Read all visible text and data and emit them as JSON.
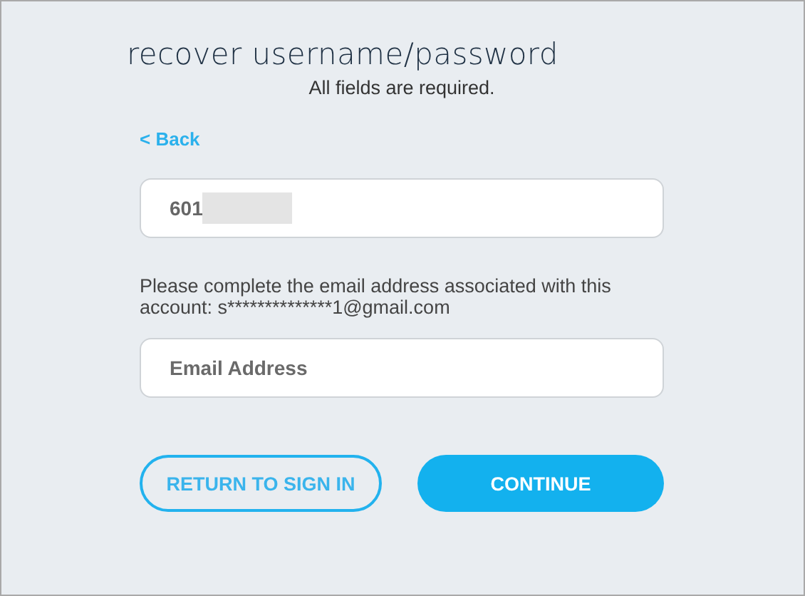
{
  "title": "recover username/password",
  "subtitle": "All fields are required.",
  "back_link": "< Back",
  "account_field": {
    "value": "601",
    "redacted": true
  },
  "instruction": "Please complete the email address associated with this account: s**************1@gmail.com",
  "email_field": {
    "placeholder": "Email Address"
  },
  "buttons": [
    {
      "label": "RETURN TO SIGN IN",
      "kind": "outline"
    },
    {
      "label": "CONTINUE",
      "kind": "primary"
    }
  ]
}
